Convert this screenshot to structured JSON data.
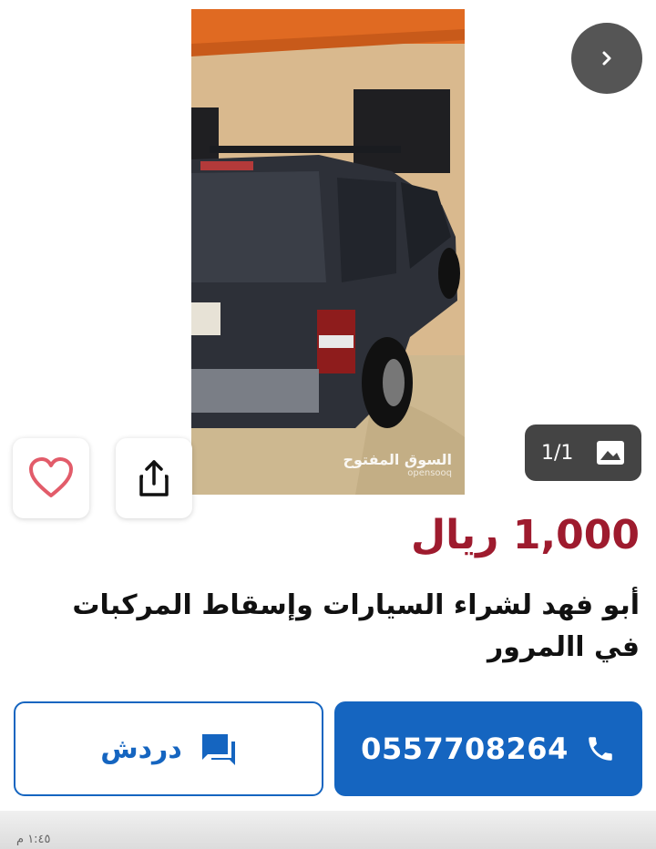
{
  "listing": {
    "price": "1,000 ريال",
    "title": "أبو فهد لشراء السيارات وإسقاط المركبات في االمرور"
  },
  "gallery": {
    "counter": "1/1",
    "watermark_main": "السوق المفتوح",
    "watermark_sub": "opensooq"
  },
  "actions": {
    "phone_number": "0557708264",
    "chat_label": "دردش"
  },
  "footer": {
    "time": "١:٤٥ م"
  },
  "colors": {
    "price": "#9e1b2e",
    "primary": "#1565c0",
    "heart": "#e25c6a"
  }
}
